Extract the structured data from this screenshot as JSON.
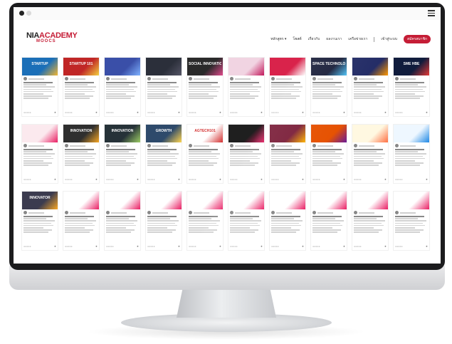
{
  "brand": {
    "part1": "NIA",
    "part2": "ACADEMY",
    "sub": "MOOCS"
  },
  "nav": {
    "items": [
      "หลักสูตร ▾",
      "โพสต์",
      "เกี่ยวกับ",
      "ผลงานเรา",
      "เครือข่ายเรา"
    ],
    "login": "เข้าสู่ระบบ",
    "signup": "สมัครสมาชิก"
  },
  "colors": {
    "brand_red": "#c51d36",
    "bezel": "#1c1c1e"
  },
  "cards": [
    {
      "title": "STARTUP",
      "bg": "#1b6fb8",
      "accent": "#f2b632"
    },
    {
      "title": "STARTUP 101",
      "bg": "#c02626",
      "accent": "#f4d03f"
    },
    {
      "title": "",
      "bg": "#3a4fa8",
      "accent": "#7fb2ff"
    },
    {
      "title": "",
      "bg": "#2b2f3a",
      "accent": "#556"
    },
    {
      "title": "SOCIAL INNOVATION",
      "bg": "#2a2a2a",
      "accent": "#e04a8c"
    },
    {
      "title": "",
      "bg": "#f1d4e2",
      "accent": "#c2185b"
    },
    {
      "title": "",
      "bg": "#d9234b",
      "accent": "#ffffff"
    },
    {
      "title": "SPACE TECHNOLOGY",
      "bg": "#1a1f3a",
      "accent": "#4fc3f7"
    },
    {
      "title": "",
      "bg": "#232c66",
      "accent": "#ff9800"
    },
    {
      "title": "SME HBE",
      "bg": "#101c3c",
      "accent": "#e53935"
    },
    {
      "title": "",
      "bg": "#fbe9ee",
      "accent": "#e91e63"
    },
    {
      "title": "INNOVATION",
      "bg": "#2f2f2f",
      "accent": "#f5a623"
    },
    {
      "title": "INNOVATION",
      "bg": "#263238",
      "accent": "#9ccc65"
    },
    {
      "title": "GROWTH",
      "bg": "#2e4a6b",
      "accent": "#ffd54f"
    },
    {
      "title": "AGTECH101",
      "bg": "#ffffff",
      "accent": "#d32f2f"
    },
    {
      "title": "",
      "bg": "#1f1f1f",
      "accent": "#e91e63"
    },
    {
      "title": "",
      "bg": "#7b1f3a",
      "accent": "#ffb300"
    },
    {
      "title": "",
      "bg": "#e65100",
      "accent": "#6a1b9a"
    },
    {
      "title": "",
      "bg": "#fff8e1",
      "accent": "#ff7043"
    },
    {
      "title": "",
      "bg": "#eef7ff",
      "accent": "#1e88e5"
    },
    {
      "title": "INNOVATOR",
      "bg": "#3b3b4f",
      "accent": "#f9a825"
    },
    {
      "title": "",
      "bg": "#ffffff",
      "accent": "#e91e63"
    },
    {
      "title": "",
      "bg": "#ffffff",
      "accent": "#e91e63"
    },
    {
      "title": "",
      "bg": "#ffffff",
      "accent": "#e91e63"
    },
    {
      "title": "",
      "bg": "#ffffff",
      "accent": "#e91e63"
    },
    {
      "title": "",
      "bg": "#ffffff",
      "accent": "#e91e63"
    },
    {
      "title": "",
      "bg": "#ffffff",
      "accent": "#e91e63"
    },
    {
      "title": "",
      "bg": "#ffffff",
      "accent": "#e91e63"
    },
    {
      "title": "",
      "bg": "#ffffff",
      "accent": "#e91e63"
    },
    {
      "title": "",
      "bg": "#ffffff",
      "accent": "#e91e63"
    }
  ]
}
